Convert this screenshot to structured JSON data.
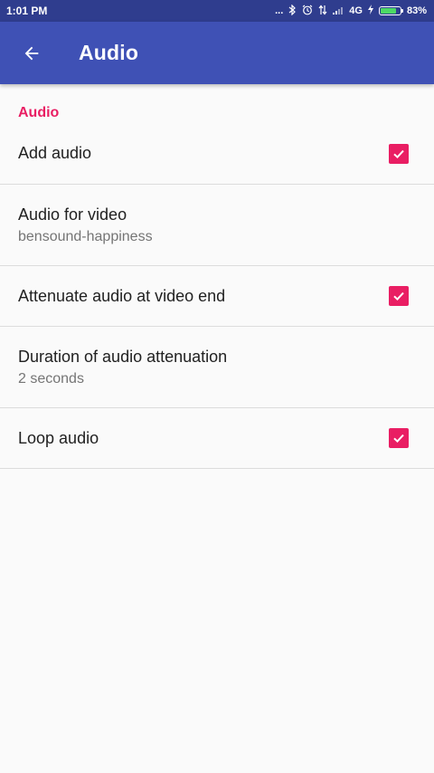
{
  "status_bar": {
    "time": "1:01 PM",
    "dots": "...",
    "icons": [
      "bluetooth-icon",
      "alarm-icon",
      "data-transfer-icon",
      "signal-icon"
    ],
    "network": "4G",
    "battery_percent": "83%",
    "battery_level": 0.83,
    "battery_color": "#4cd964"
  },
  "app_bar": {
    "back_icon": "arrow-left-icon",
    "title": "Audio",
    "color": "#3f51b5"
  },
  "section": {
    "header": "Audio",
    "accent_color": "#e91e63"
  },
  "preferences": [
    {
      "title": "Add audio",
      "checked": true
    },
    {
      "title": "Audio for video",
      "summary": "bensound-happiness"
    },
    {
      "title": "Attenuate audio at video end",
      "checked": true
    },
    {
      "title": "Duration of audio attenuation",
      "summary": "2 seconds"
    },
    {
      "title": "Loop audio",
      "checked": true
    }
  ]
}
